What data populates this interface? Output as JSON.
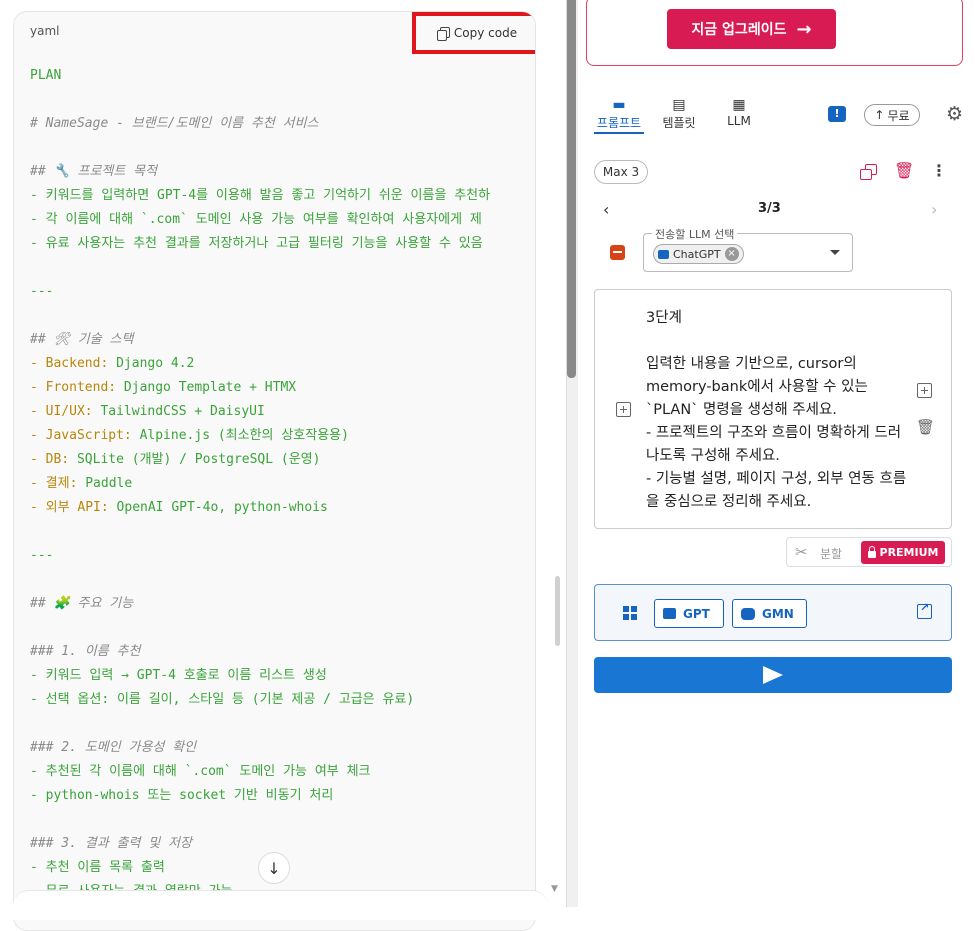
{
  "code_panel": {
    "language": "yaml",
    "copy_label": "Copy code",
    "lines": [
      {
        "t": "PLAN",
        "c": "c-green"
      },
      {
        "t": "",
        "c": ""
      },
      {
        "t": "# NameSage - 브랜드/도메인 이름 추천 서비스",
        "c": "c-comment"
      },
      {
        "t": "",
        "c": ""
      },
      {
        "t": "## 🔧 프로젝트 목적",
        "c": "c-comment"
      },
      {
        "t": "- 키워드를 입력하면 GPT-4를 이용해 발음 좋고 기억하기 쉬운 이름을 추천하",
        "c": "c-green"
      },
      {
        "t": "- 각 이름에 대해 `.com` 도메인 사용 가능 여부를 확인하여 사용자에게 제",
        "c": "c-green"
      },
      {
        "t": "- 유료 사용자는 추천 결과를 저장하거나 고급 필터링 기능을 사용할 수 있음",
        "c": "c-green"
      },
      {
        "t": "",
        "c": ""
      },
      {
        "t": "---",
        "c": "c-green"
      },
      {
        "t": "",
        "c": ""
      },
      {
        "t": "## 🛠 기술 스택",
        "c": "c-comment"
      },
      {
        "k": "- Backend:",
        "v": " Django 4.2"
      },
      {
        "k": "- Frontend:",
        "v": " Django Template + HTMX"
      },
      {
        "k": "- UI/UX:",
        "v": " TailwindCSS + DaisyUI"
      },
      {
        "k": "- JavaScript:",
        "v": " Alpine.js (최소한의 상호작용용)"
      },
      {
        "k": "- DB:",
        "v": " SQLite (개발) / PostgreSQL (운영)"
      },
      {
        "k": "- 결제:",
        "v": " Paddle"
      },
      {
        "k": "- 외부 API:",
        "v": " OpenAI GPT-4o, python-whois"
      },
      {
        "t": "",
        "c": ""
      },
      {
        "t": "---",
        "c": "c-green"
      },
      {
        "t": "",
        "c": ""
      },
      {
        "t": "## 🧩 주요 기능",
        "c": "c-comment"
      },
      {
        "t": "",
        "c": ""
      },
      {
        "t": "### 1. 이름 추천",
        "c": "c-comment"
      },
      {
        "t": "- 키워드 입력 → GPT-4 호출로 이름 리스트 생성",
        "c": "c-green"
      },
      {
        "t": "- 선택 옵션: 이름 길이, 스타일 등 (기본 제공 / 고급은 유료)",
        "c": "c-green"
      },
      {
        "t": "",
        "c": ""
      },
      {
        "t": "### 2. 도메인 가용성 확인",
        "c": "c-comment"
      },
      {
        "t": "- 추천된 각 이름에 대해 `.com` 도메인 가능 여부 체크",
        "c": "c-green"
      },
      {
        "t": "- python-whois 또는 socket 기반 비동기 처리",
        "c": "c-green"
      },
      {
        "t": "",
        "c": ""
      },
      {
        "t": "### 3. 결과 출력 및 저장",
        "c": "c-comment"
      },
      {
        "t": "- 추천 이름 목록 출력",
        "c": "c-green"
      },
      {
        "t": "- 무료 사용자는 결과 열람만 가능",
        "c": "c-green"
      }
    ],
    "scroll_down_label": "↓"
  },
  "sidebar": {
    "upgrade_label": "지금 업그레이드",
    "tabs": [
      {
        "label": "프롬프트",
        "active": true
      },
      {
        "label": "템플릿",
        "active": false
      },
      {
        "label": "LLM",
        "active": false
      }
    ],
    "free_label": "무료",
    "max_chip": "Max 3",
    "pager": "3/3",
    "llm_select_legend": "전송할 LLM 선택",
    "llm_chip": "ChatGPT",
    "prompt_text": "3단계\n\n입력한 내용을 기반으로, cursor의 memory-bank에서 사용할 수 있는 `PLAN` 명령을 생성해 주세요.\n- 프로젝트의 구조와 흐름이 명확하게 드러나도록 구성해 주세요.\n- 기능별 설명, 페이지 구성, 외부 연동 흐름을 중심으로 정리해 주세요.",
    "split_label": "분할",
    "premium_label": "PREMIUM",
    "gpt_button": "GPT",
    "gmn_button": "GMN",
    "colors": {
      "brand_pink": "#d81b52",
      "primary_blue": "#1976d2",
      "highlight_red": "#e0161d"
    }
  }
}
